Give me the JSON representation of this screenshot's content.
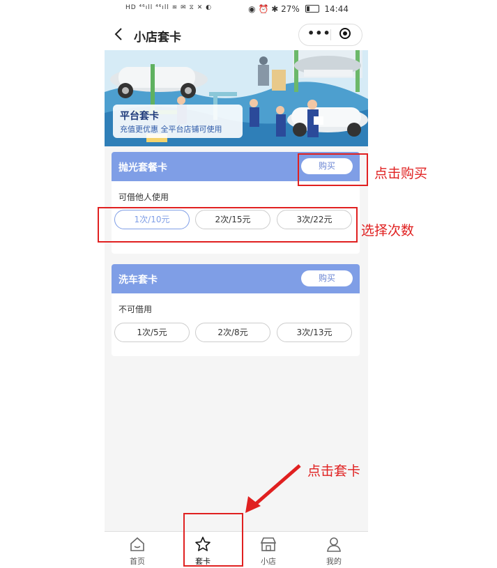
{
  "status_bar": {
    "left": "HD ⁴⁶ıll ⁴⁶ıll ≋ ✉ ⧖ ✕ ◐",
    "right": "◉ ⏰ ✱ 27%",
    "time": "14:44"
  },
  "nav": {
    "title": "小店套卡",
    "more": "•••"
  },
  "banner": {
    "title": "平台套卡",
    "subtitle": "充值更优惠  全平台店铺可使用"
  },
  "cards": [
    {
      "title": "抛光套餐卡",
      "buy_label": "购买",
      "note": "可借他人使用",
      "options": [
        "1次/10元",
        "2次/15元",
        "3次/22元"
      ],
      "selected_index": 0
    },
    {
      "title": "洗车套卡",
      "buy_label": "购买",
      "note": "不可借用",
      "options": [
        "1次/5元",
        "2次/8元",
        "3次/13元"
      ]
    }
  ],
  "tabs": [
    {
      "label": "首页",
      "icon": "home-icon"
    },
    {
      "label": "套卡",
      "icon": "star-icon",
      "active": true
    },
    {
      "label": "小店",
      "icon": "shop-icon"
    },
    {
      "label": "我的",
      "icon": "user-icon"
    }
  ],
  "annotations": {
    "buy": "点击购买",
    "select": "选择次数",
    "tab": "点击套卡"
  },
  "colors": {
    "accent": "#7f9ee6",
    "annotation": "#e02020"
  }
}
